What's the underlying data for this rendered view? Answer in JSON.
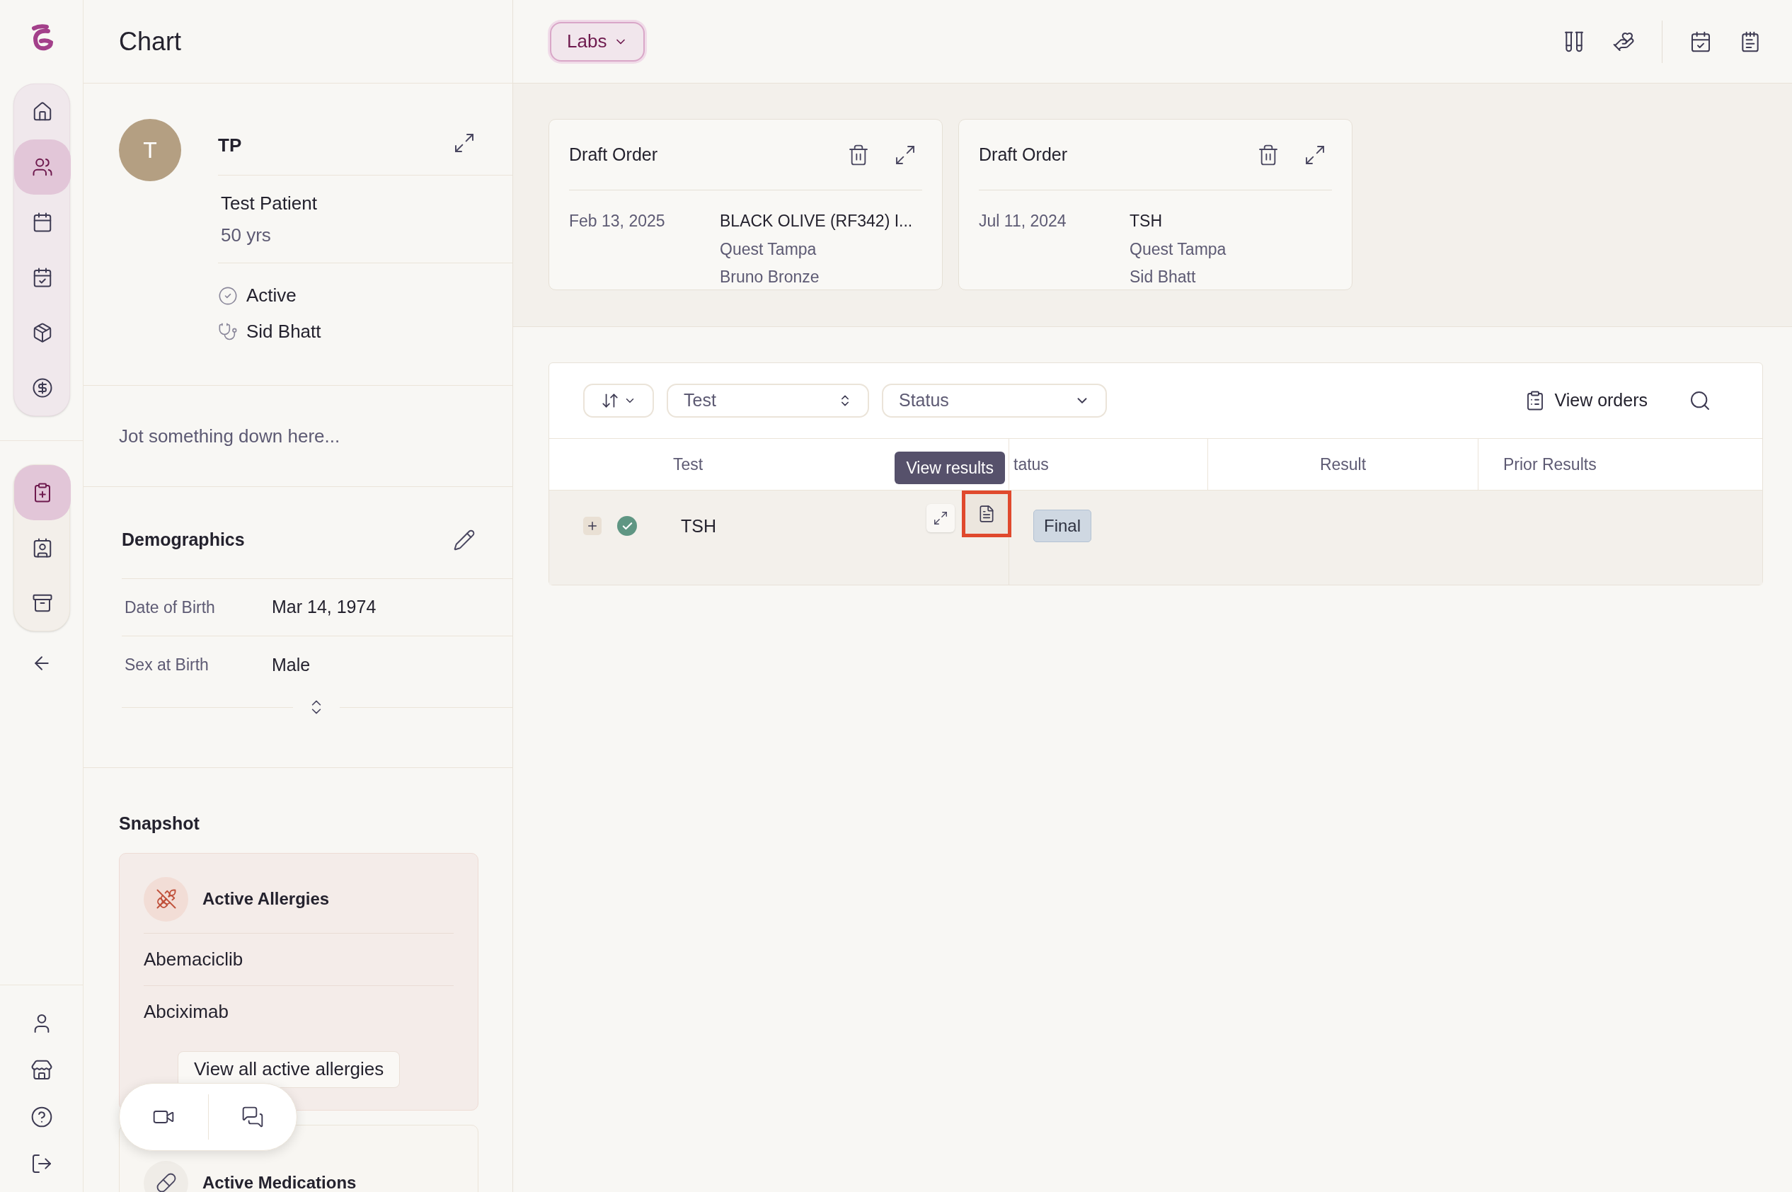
{
  "nav": {
    "primary": [
      {
        "selected": false
      },
      {
        "selected": true
      },
      {
        "selected": false
      },
      {
        "selected": false
      },
      {
        "selected": false
      },
      {
        "selected": false
      }
    ],
    "secondary": [
      {
        "selected": true
      },
      {
        "selected": false
      },
      {
        "selected": false
      }
    ]
  },
  "panel": {
    "title": "Chart"
  },
  "patient": {
    "initial": "T",
    "short_name": "TP",
    "name": "Test Patient",
    "age": "50 yrs",
    "status": "Active",
    "provider": "Sid Bhatt"
  },
  "notes": {
    "placeholder": "Jot something down here..."
  },
  "demographics": {
    "title": "Demographics",
    "fields": [
      {
        "label": "Date of Birth",
        "value": "Mar 14, 1974"
      },
      {
        "label": "Sex at Birth",
        "value": "Male"
      }
    ]
  },
  "snapshot": {
    "title": "Snapshot",
    "allergies": {
      "title": "Active Allergies",
      "items": [
        "Abemaciclib",
        "Abciximab"
      ],
      "button": "View all active allergies"
    },
    "medications": {
      "title": "Active Medications"
    }
  },
  "header": {
    "dropdown": "Labs"
  },
  "draft_orders": [
    {
      "title": "Draft Order",
      "date": "Feb 13, 2025",
      "test": "BLACK OLIVE (RF342) I...",
      "lab": "Quest Tampa",
      "provider": "Bruno Bronze"
    },
    {
      "title": "Draft Order",
      "date": "Jul 11, 2024",
      "test": "TSH",
      "lab": "Quest Tampa",
      "provider": "Sid Bhatt"
    }
  ],
  "table": {
    "filters": {
      "test": "Test",
      "status": "Status"
    },
    "view_orders": "View orders",
    "columns": [
      "Test",
      "tatus",
      "Result",
      "Prior Results"
    ],
    "rows": [
      {
        "test": "TSH",
        "status": "Final",
        "complete": true
      }
    ],
    "tooltip": "View results"
  }
}
